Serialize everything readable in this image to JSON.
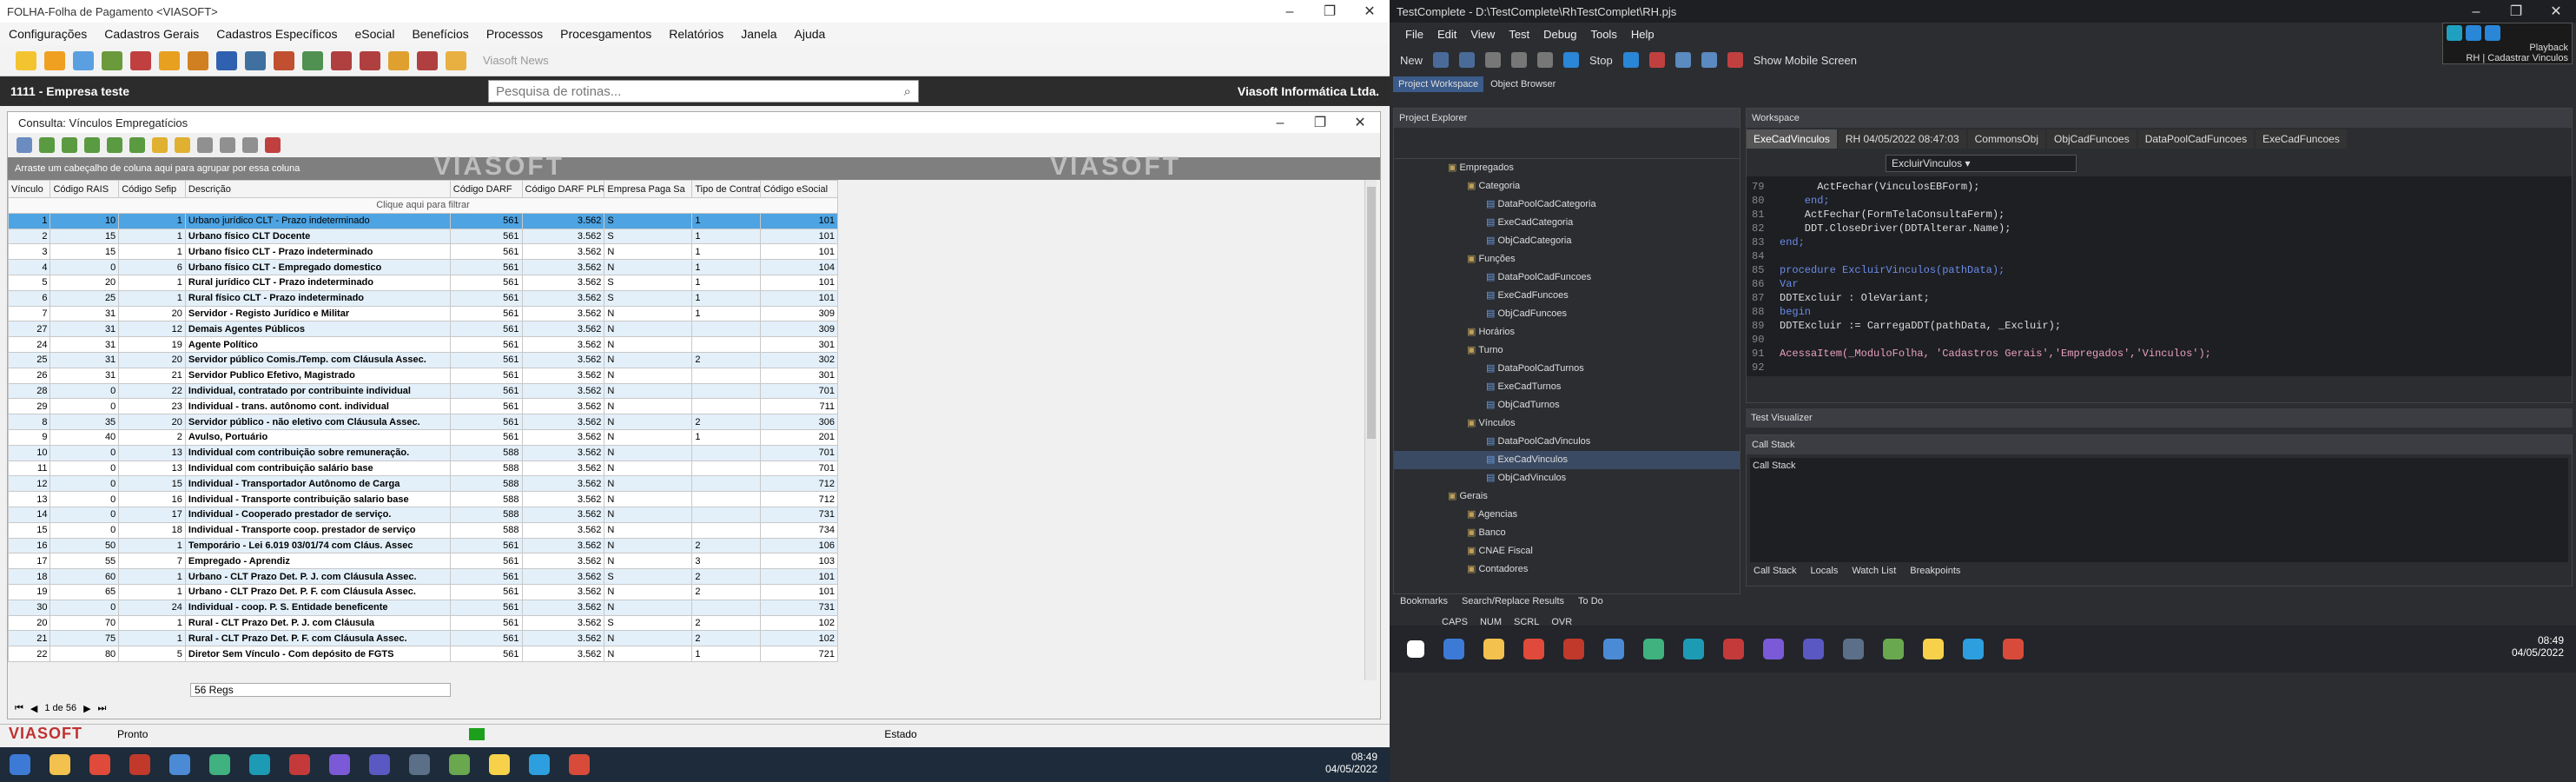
{
  "left_window": {
    "title": "FOLHA-Folha de Pagamento <VIASOFT>",
    "menus": [
      "Configurações",
      "Cadastros Gerais",
      "Cadastros Específicos",
      "eSocial",
      "Benefícios",
      "Processos",
      "Procesgamentos",
      "Relatórios",
      "Janela",
      "Ajuda"
    ],
    "news_label": "Viasoft News",
    "company": "1111 - Empresa teste",
    "search_placeholder": "Pesquisa de rotinas...",
    "vendor": "Viasoft Informática Ltda.",
    "child_title": "Consulta: Vínculos Empregatícios",
    "group_hint": "Arraste um cabeçalho de coluna aqui para agrupar por essa coluna",
    "logo_text": "VIASOFT",
    "filter_hint": "Clique aqui para filtrar",
    "columns": [
      "Vínculo",
      "Código RAIS",
      "Código Sefip",
      "Descrição",
      "Código DARF",
      "Código DARF PLR",
      "Empresa Paga Sa",
      "Tipo de Contrat",
      "Código eSocial"
    ],
    "rows": [
      [
        "1",
        "10",
        "1",
        "Urbano jurídico CLT - Prazo indeterminado",
        "561",
        "3.562",
        "S",
        "1",
        "101"
      ],
      [
        "2",
        "15",
        "1",
        "Urbano físico CLT Docente",
        "561",
        "3.562",
        "S",
        "1",
        "101"
      ],
      [
        "3",
        "15",
        "1",
        "Urbano físico CLT - Prazo indeterminado",
        "561",
        "3.562",
        "N",
        "1",
        "101"
      ],
      [
        "4",
        "0",
        "6",
        "Urbano físico CLT - Empregado domestico",
        "561",
        "3.562",
        "N",
        "1",
        "104"
      ],
      [
        "5",
        "20",
        "1",
        "Rural jurídico CLT - Prazo indeterminado",
        "561",
        "3.562",
        "S",
        "1",
        "101"
      ],
      [
        "6",
        "25",
        "1",
        "Rural físico CLT - Prazo indeterminado",
        "561",
        "3.562",
        "S",
        "1",
        "101"
      ],
      [
        "7",
        "31",
        "20",
        "Servidor - Registo Jurídico e Militar",
        "561",
        "3.562",
        "N",
        "1",
        "309"
      ],
      [
        "27",
        "31",
        "12",
        "Demais Agentes Públicos",
        "561",
        "3.562",
        "N",
        "",
        "309"
      ],
      [
        "24",
        "31",
        "19",
        "Agente Político",
        "561",
        "3.562",
        "N",
        "",
        "301"
      ],
      [
        "25",
        "31",
        "20",
        "Servidor público Comis./Temp. com Cláusula Assec.",
        "561",
        "3.562",
        "N",
        "2",
        "302"
      ],
      [
        "26",
        "31",
        "21",
        "Servidor Publico Efetivo, Magistrado",
        "561",
        "3.562",
        "N",
        "",
        "301"
      ],
      [
        "28",
        "0",
        "22",
        "Individual, contratado por contribuinte individual",
        "561",
        "3.562",
        "N",
        "",
        "701"
      ],
      [
        "29",
        "0",
        "23",
        "Individual - trans. autônomo cont. individual",
        "561",
        "3.562",
        "N",
        "",
        "711"
      ],
      [
        "8",
        "35",
        "20",
        "Servidor público - não eletivo com Cláusula Assec.",
        "561",
        "3.562",
        "N",
        "2",
        "306"
      ],
      [
        "9",
        "40",
        "2",
        "Avulso, Portuário",
        "561",
        "3.562",
        "N",
        "1",
        "201"
      ],
      [
        "10",
        "0",
        "13",
        "Individual com contribuição sobre remuneração.",
        "588",
        "3.562",
        "N",
        "",
        "701"
      ],
      [
        "11",
        "0",
        "13",
        "Individual com contribuição salário base",
        "588",
        "3.562",
        "N",
        "",
        "701"
      ],
      [
        "12",
        "0",
        "15",
        "Individual - Transportador Autônomo de Carga",
        "588",
        "3.562",
        "N",
        "",
        "712"
      ],
      [
        "13",
        "0",
        "16",
        "Individual - Transporte contribuição salario base",
        "588",
        "3.562",
        "N",
        "",
        "712"
      ],
      [
        "14",
        "0",
        "17",
        "Individual - Cooperado prestador de serviço.",
        "588",
        "3.562",
        "N",
        "",
        "731"
      ],
      [
        "15",
        "0",
        "18",
        "Individual - Transporte coop. prestador de serviço",
        "588",
        "3.562",
        "N",
        "",
        "734"
      ],
      [
        "16",
        "50",
        "1",
        "Temporário - Lei 6.019 03/01/74 com Cláus. Assec",
        "561",
        "3.562",
        "N",
        "2",
        "106"
      ],
      [
        "17",
        "55",
        "7",
        "Empregado - Aprendiz",
        "561",
        "3.562",
        "N",
        "3",
        "103"
      ],
      [
        "18",
        "60",
        "1",
        "Urbano - CLT Prazo Det. P. J. com Cláusula Assec.",
        "561",
        "3.562",
        "S",
        "2",
        "101"
      ],
      [
        "19",
        "65",
        "1",
        "Urbano - CLT Prazo Det. P. F. com Cláusula Assec.",
        "561",
        "3.562",
        "N",
        "2",
        "101"
      ],
      [
        "30",
        "0",
        "24",
        "Individual - coop. P. S. Entidade beneficente",
        "561",
        "3.562",
        "N",
        "",
        "731"
      ],
      [
        "20",
        "70",
        "1",
        "Rural - CLT Prazo Det. P. J. com Cláusula",
        "561",
        "3.562",
        "S",
        "2",
        "102"
      ],
      [
        "21",
        "75",
        "1",
        "Rural - CLT Prazo Det. P. F. com Cláusula Assec.",
        "561",
        "3.562",
        "N",
        "2",
        "102"
      ],
      [
        "22",
        "80",
        "5",
        "Diretor Sem Vínculo - Com depósito de FGTS",
        "561",
        "3.562",
        "N",
        "1",
        "721"
      ]
    ],
    "reg_count": "56 Regs",
    "pager": "1 de 56",
    "status_left": "Pronto",
    "status_right": "Estado",
    "clock_time": "08:49",
    "clock_date": "04/05/2022"
  },
  "right_window": {
    "title": "TestComplete - D:\\TestComplete\\RhTestComplet\\RH.pjs",
    "menus": [
      "File",
      "Edit",
      "View",
      "Test",
      "Debug",
      "Tools",
      "Help"
    ],
    "new_label": "New",
    "stop_label": "Stop",
    "mobile_label": "Show Mobile Screen",
    "playback_label": "Playback",
    "playback_sub": "RH | Cadastrar Vinculos",
    "tabs_left": [
      "Project Workspace",
      "Object Browser"
    ],
    "explorer_title": "Project Explorer",
    "workspace_title": "Workspace",
    "doc_tabs": [
      "ExeCadVinculos",
      "RH 04/05/2022 08:47:03",
      "CommonsObj",
      "ObjCadFuncoes",
      "DataPoolCadFuncoes",
      "ExeCadFuncoes"
    ],
    "routine_select": "ExcluirVinculos",
    "tree": [
      {
        "label": "Empregados",
        "indent": 1,
        "kind": "folder"
      },
      {
        "label": "Categoria",
        "indent": 2,
        "kind": "folder"
      },
      {
        "label": "DataPoolCadCategoria",
        "indent": 3,
        "kind": "item"
      },
      {
        "label": "ExeCadCategoria",
        "indent": 3,
        "kind": "item"
      },
      {
        "label": "ObjCadCategoria",
        "indent": 3,
        "kind": "item"
      },
      {
        "label": "Funções",
        "indent": 2,
        "kind": "folder"
      },
      {
        "label": "DataPoolCadFuncoes",
        "indent": 3,
        "kind": "item"
      },
      {
        "label": "ExeCadFuncoes",
        "indent": 3,
        "kind": "item"
      },
      {
        "label": "ObjCadFuncoes",
        "indent": 3,
        "kind": "item"
      },
      {
        "label": "Horários",
        "indent": 2,
        "kind": "folder"
      },
      {
        "label": "Turno",
        "indent": 2,
        "kind": "folder"
      },
      {
        "label": "DataPoolCadTurnos",
        "indent": 3,
        "kind": "item"
      },
      {
        "label": "ExeCadTurnos",
        "indent": 3,
        "kind": "item"
      },
      {
        "label": "ObjCadTurnos",
        "indent": 3,
        "kind": "item"
      },
      {
        "label": "Vínculos",
        "indent": 2,
        "kind": "folder"
      },
      {
        "label": "DataPoolCadVinculos",
        "indent": 3,
        "kind": "item"
      },
      {
        "label": "ExeCadVinculos",
        "indent": 3,
        "kind": "item"
      },
      {
        "label": "ObjCadVinculos",
        "indent": 3,
        "kind": "item"
      },
      {
        "label": "Gerais",
        "indent": 1,
        "kind": "folder"
      },
      {
        "label": "Agencias",
        "indent": 2,
        "kind": "folder"
      },
      {
        "label": "Banco",
        "indent": 2,
        "kind": "folder"
      },
      {
        "label": "CNAE Fiscal",
        "indent": 2,
        "kind": "folder"
      },
      {
        "label": "Contadores",
        "indent": 2,
        "kind": "folder"
      }
    ],
    "code_lines": [
      {
        "n": "79",
        "t": "      ActFechar(VinculosEBForm);"
      },
      {
        "n": "80",
        "t": "    end;"
      },
      {
        "n": "81",
        "t": "    ActFechar(FormTelaConsultaFerm);"
      },
      {
        "n": "82",
        "t": "    DDT.CloseDriver(DDTAlterar.Name);"
      },
      {
        "n": "83",
        "t": "end;"
      },
      {
        "n": "84",
        "t": ""
      },
      {
        "n": "85",
        "t": "procedure ExcluirVinculos(pathData);"
      },
      {
        "n": "86",
        "t": "Var"
      },
      {
        "n": "87",
        "t": "DDTExcluir : OleVariant;"
      },
      {
        "n": "88",
        "t": "begin"
      },
      {
        "n": "89",
        "t": "DDTExcluir := CarregaDDT(pathData, _Excluir);"
      },
      {
        "n": "90",
        "t": ""
      },
      {
        "n": "91",
        "t": "AcessaItem(_ModuloFolha, 'Cadastros Gerais','Empregados','Vinculos');"
      },
      {
        "n": "92",
        "t": ""
      }
    ],
    "visualizer": "Test Visualizer",
    "callstack_title": "Call Stack",
    "callstack_label": "Call Stack",
    "bottom_tabs": [
      "Call Stack",
      "Locals",
      "Watch List",
      "Breakpoints"
    ],
    "left_bottom_tabs": [
      "Bookmarks",
      "Search/Replace Results",
      "To Do"
    ],
    "keys": [
      "CAPS",
      "NUM",
      "SCRL",
      "OVR"
    ],
    "clock_time": "08:49",
    "clock_date": "04/05/2022"
  }
}
